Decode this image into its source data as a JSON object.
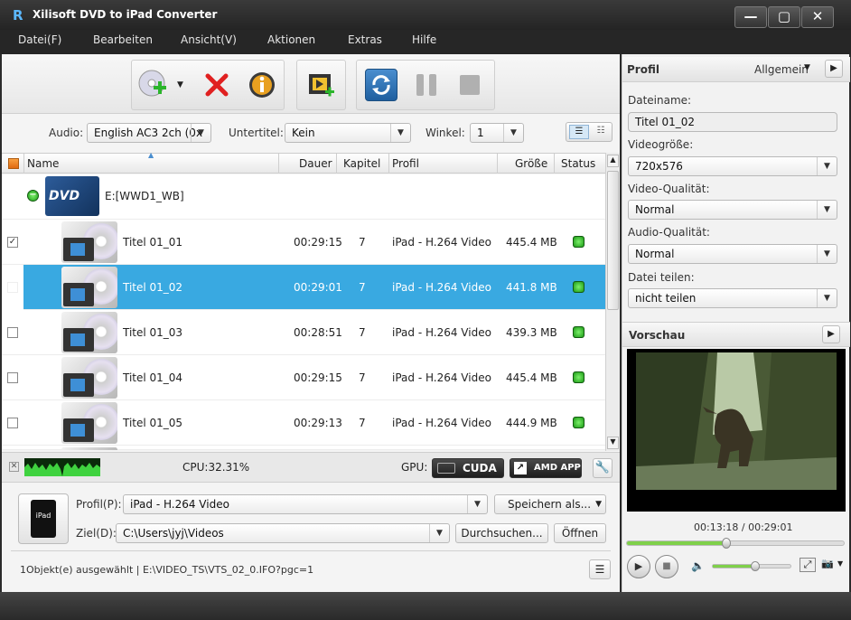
{
  "window": {
    "title": "Xilisoft DVD to iPad Converter",
    "minimize_label": "—",
    "maximize_label": "▢",
    "close_label": "✕"
  },
  "menu": [
    "Datei(F)",
    "Bearbeiten",
    "Ansicht(V)",
    "Aktionen",
    "Extras",
    "Hilfe"
  ],
  "filters": {
    "audio_label": "Audio:",
    "audio_value": "English AC3 2ch (0x",
    "subtitle_label": "Untertitel:",
    "subtitle_value": "Kein",
    "angle_label": "Winkel:",
    "angle_value": "1"
  },
  "table": {
    "headers": [
      "Name",
      "Dauer",
      "Kapitel",
      "Profil",
      "Größe",
      "Status"
    ],
    "source": {
      "label": "E:[WWD1_WB]",
      "dvd_text": "DVD"
    },
    "rows": [
      {
        "name": "Titel 01_01",
        "duration": "00:29:15",
        "chapters": "7",
        "profile": "iPad - H.264 Video",
        "size": "445.4 MB",
        "checked": "✓"
      },
      {
        "name": "Titel 01_02",
        "duration": "00:29:01",
        "chapters": "7",
        "profile": "iPad - H.264 Video",
        "size": "441.8 MB",
        "checked": ""
      },
      {
        "name": "Titel 01_03",
        "duration": "00:28:51",
        "chapters": "7",
        "profile": "iPad - H.264 Video",
        "size": "439.3 MB",
        "checked": ""
      },
      {
        "name": "Titel 01_04",
        "duration": "00:29:15",
        "chapters": "7",
        "profile": "iPad - H.264 Video",
        "size": "445.4 MB",
        "checked": ""
      },
      {
        "name": "Titel 01_05",
        "duration": "00:29:13",
        "chapters": "7",
        "profile": "iPad - H.264 Video",
        "size": "444.9 MB",
        "checked": ""
      }
    ]
  },
  "cpu": {
    "cpu_text": "CPU:32.31%",
    "gpu_label": "GPU:",
    "cuda_label": "CUDA",
    "amd_label": "AMD APP"
  },
  "output": {
    "device_label": "iPad",
    "profile_label": "Profil(P):",
    "profile_value": "iPad - H.264 Video",
    "save_as_label": "Speichern als...",
    "dest_label": "Ziel(D):",
    "dest_value": "C:\\Users\\jyj\\Videos",
    "browse_label": "Durchsuchen...",
    "open_label": "Öffnen"
  },
  "statusbar": {
    "text": "1Objekt(e) ausgewählt | E:\\VIDEO_TS\\VTS_02_0.IFO?pgc=1"
  },
  "profile_panel": {
    "title": "Profil",
    "mode": "Allgemein",
    "filename_label": "Dateiname:",
    "filename_value": "Titel 01_02",
    "videosize_label": "Videogröße:",
    "videosize_value": "720x576",
    "videoquality_label": "Video-Qualität:",
    "videoquality_value": "Normal",
    "audioquality_label": "Audio-Qualität:",
    "audioquality_value": "Normal",
    "split_label": "Datei teilen:",
    "split_value": "nicht teilen"
  },
  "preview": {
    "title": "Vorschau",
    "time": "00:13:18 / 00:29:01",
    "progress": 0.458,
    "volume": 0.55
  },
  "colors": {
    "selection": "#39a9e1",
    "status_ok": "#2ecc40",
    "progress_fill": "#7fd04a"
  }
}
